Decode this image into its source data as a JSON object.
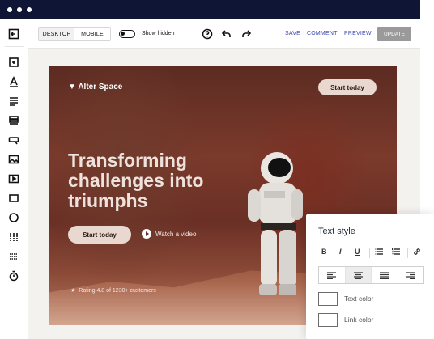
{
  "toolbar": {
    "view_modes": [
      "DESKTOP",
      "MOBILE"
    ],
    "active_view": "DESKTOP",
    "show_hidden_label": "Show hidden",
    "save_label": "SAVE",
    "comment_label": "COMMENT",
    "preview_label": "PREVIEW",
    "update_label": "UPDATE"
  },
  "sidebar": {
    "icons": [
      "exit-icon",
      "section-icon",
      "text-icon",
      "paragraph-icon",
      "list-icon",
      "button-icon",
      "image-icon",
      "video-icon",
      "box-icon",
      "circle-icon",
      "columns-icon",
      "divider-icon",
      "timer-icon"
    ]
  },
  "hero": {
    "brand": "Alter Space",
    "top_button": "Start today",
    "headline": "Transforming challenges into triumphs",
    "cta_button": "Start today",
    "watch_label": "Watch a video",
    "rating": "Rating 4.8 of 1230+ customers"
  },
  "text_style_panel": {
    "title": "Text style",
    "format_buttons": [
      "B",
      "I",
      "U"
    ],
    "active_align": "center",
    "text_color_label": "Text color",
    "link_color_label": "Link color"
  },
  "colors": {
    "titlebar": "#0f1535",
    "link_blue": "#3b46b0",
    "update_bg": "#9a9a9a",
    "hero_button": "#e9d8d0"
  }
}
